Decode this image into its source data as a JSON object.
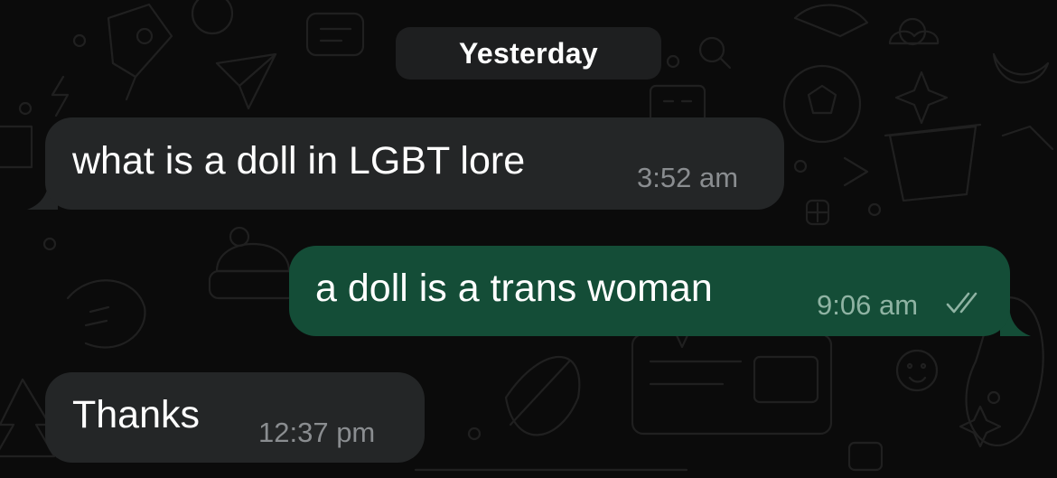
{
  "chat": {
    "date_label": "Yesterday",
    "messages": [
      {
        "direction": "incoming",
        "text": "what is a doll in LGBT lore",
        "time": "3:52 am"
      },
      {
        "direction": "outgoing",
        "text": "a doll is a trans woman",
        "time": "9:06 am",
        "status_icon": "double-check-icon"
      },
      {
        "direction": "incoming",
        "text": "Thanks",
        "time": "12:37 pm"
      }
    ]
  },
  "colors": {
    "background": "#0b0b0b",
    "incoming_bubble": "#242627",
    "outgoing_bubble": "#144d37",
    "date_chip": "#1e1f20",
    "text": "#ffffff",
    "incoming_time": "#8a8d90",
    "outgoing_time": "#8fb3a3"
  }
}
